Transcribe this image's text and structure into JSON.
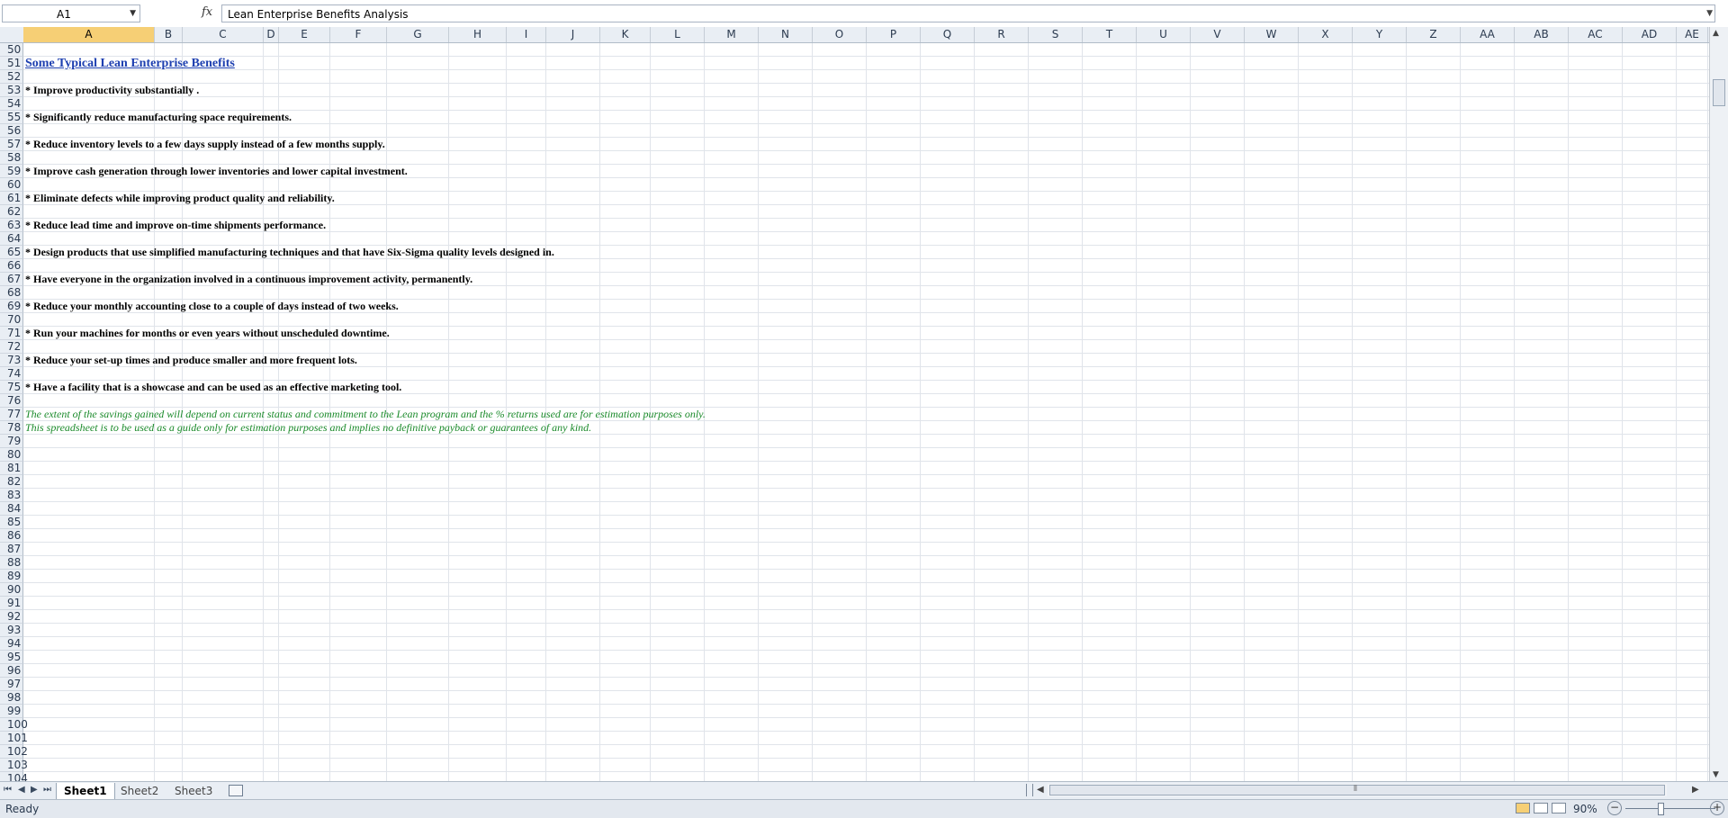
{
  "formula_bar": {
    "name_box": "A1",
    "fx_label": "fx",
    "formula": "Lean Enterprise Benefits Analysis"
  },
  "columns": [
    "A",
    "B",
    "C",
    "D",
    "E",
    "F",
    "G",
    "H",
    "I",
    "J",
    "K",
    "L",
    "M",
    "N",
    "O",
    "P",
    "Q",
    "R",
    "S",
    "T",
    "U",
    "V",
    "W",
    "X",
    "Y",
    "Z",
    "AA",
    "AB",
    "AC",
    "AD",
    "AE"
  ],
  "active_column": "A",
  "rows": [
    {
      "num": "50",
      "text": "",
      "style": ""
    },
    {
      "num": "51",
      "text": "Some Typical Lean Enterprise Benefits",
      "style": "title"
    },
    {
      "num": "52",
      "text": "",
      "style": ""
    },
    {
      "num": "53",
      "text": "* Improve productivity substantially .",
      "style": "bold"
    },
    {
      "num": "54",
      "text": "",
      "style": ""
    },
    {
      "num": "55",
      "text": "* Significantly reduce manufacturing space requirements.",
      "style": "bold"
    },
    {
      "num": "56",
      "text": "",
      "style": ""
    },
    {
      "num": "57",
      "text": "* Reduce inventory levels to a few days supply instead of a few months supply.",
      "style": "bold"
    },
    {
      "num": "58",
      "text": "",
      "style": ""
    },
    {
      "num": "59",
      "text": "* Improve cash generation through lower inventories and lower capital investment.",
      "style": "bold"
    },
    {
      "num": "60",
      "text": "",
      "style": ""
    },
    {
      "num": "61",
      "text": "* Eliminate defects while improving product quality and reliability.",
      "style": "bold"
    },
    {
      "num": "62",
      "text": "",
      "style": ""
    },
    {
      "num": "63",
      "text": "* Reduce lead time and improve on-time shipments performance.",
      "style": "bold"
    },
    {
      "num": "64",
      "text": "",
      "style": ""
    },
    {
      "num": "65",
      "text": "* Design products that use simplified manufacturing techniques and that have Six-Sigma quality levels designed in.",
      "style": "bold"
    },
    {
      "num": "66",
      "text": "",
      "style": ""
    },
    {
      "num": "67",
      "text": "* Have everyone in the organization involved in a continuous improvement activity, permanently.",
      "style": "bold"
    },
    {
      "num": "68",
      "text": "",
      "style": ""
    },
    {
      "num": "69",
      "text": "* Reduce your monthly accounting close to a couple of days instead of two weeks.",
      "style": "bold"
    },
    {
      "num": "70",
      "text": "",
      "style": ""
    },
    {
      "num": "71",
      "text": "* Run your machines for months or even years without unscheduled downtime.",
      "style": "bold"
    },
    {
      "num": "72",
      "text": "",
      "style": ""
    },
    {
      "num": "73",
      "text": "* Reduce your set-up times and produce smaller and more frequent lots.",
      "style": "bold"
    },
    {
      "num": "74",
      "text": "",
      "style": ""
    },
    {
      "num": "75",
      "text": "* Have a facility that is a showcase and can be used as an effective marketing tool.",
      "style": "bold"
    },
    {
      "num": "76",
      "text": "",
      "style": ""
    },
    {
      "num": "77",
      "text": "The extent of the savings gained will depend on current status and commitment to the Lean program and the % returns used are for estimation purposes only.",
      "style": "note"
    },
    {
      "num": "78",
      "text": "This spreadsheet is to be used as a guide only for estimation purposes and implies no definitive payback or guarantees of any kind.",
      "style": "note"
    },
    {
      "num": "79",
      "text": "",
      "style": ""
    },
    {
      "num": "80",
      "text": "",
      "style": ""
    },
    {
      "num": "81",
      "text": "",
      "style": ""
    },
    {
      "num": "82",
      "text": "",
      "style": ""
    },
    {
      "num": "83",
      "text": "",
      "style": ""
    },
    {
      "num": "84",
      "text": "",
      "style": ""
    },
    {
      "num": "85",
      "text": "",
      "style": ""
    },
    {
      "num": "86",
      "text": "",
      "style": ""
    },
    {
      "num": "87",
      "text": "",
      "style": ""
    },
    {
      "num": "88",
      "text": "",
      "style": ""
    },
    {
      "num": "89",
      "text": "",
      "style": ""
    },
    {
      "num": "90",
      "text": "",
      "style": ""
    },
    {
      "num": "91",
      "text": "",
      "style": ""
    },
    {
      "num": "92",
      "text": "",
      "style": ""
    },
    {
      "num": "93",
      "text": "",
      "style": ""
    },
    {
      "num": "94",
      "text": "",
      "style": ""
    },
    {
      "num": "95",
      "text": "",
      "style": ""
    },
    {
      "num": "96",
      "text": "",
      "style": ""
    },
    {
      "num": "97",
      "text": "",
      "style": ""
    },
    {
      "num": "98",
      "text": "",
      "style": ""
    },
    {
      "num": "99",
      "text": "",
      "style": ""
    },
    {
      "num": "100",
      "text": "",
      "style": ""
    },
    {
      "num": "101",
      "text": "",
      "style": ""
    },
    {
      "num": "102",
      "text": "",
      "style": ""
    },
    {
      "num": "103",
      "text": "",
      "style": ""
    },
    {
      "num": "104",
      "text": "",
      "style": ""
    }
  ],
  "sheet_tabs": [
    {
      "label": "Sheet1",
      "active": true
    },
    {
      "label": "Sheet2",
      "active": false
    },
    {
      "label": "Sheet3",
      "active": false
    }
  ],
  "status_bar": {
    "status": "Ready",
    "zoom": "90%"
  },
  "colors": {
    "title": "#1d3fb0",
    "note": "#1a8a2a",
    "active_header": "#f6cf75"
  }
}
